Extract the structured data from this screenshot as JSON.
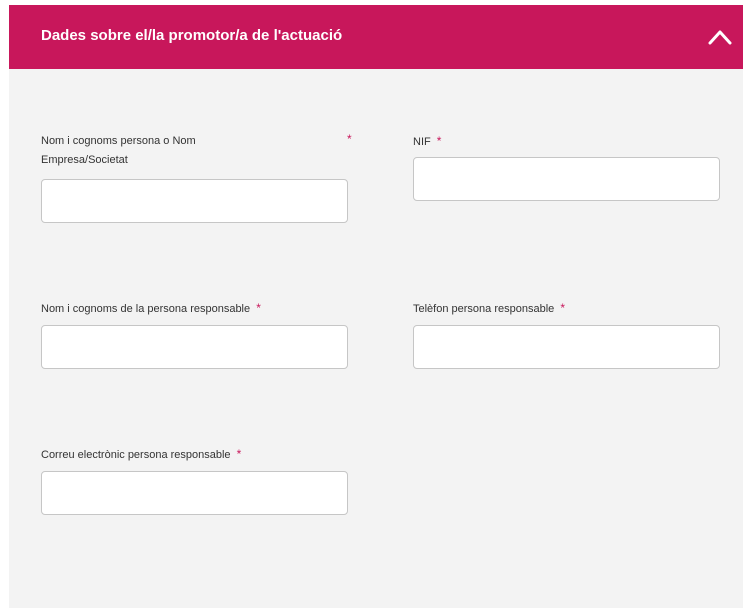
{
  "section": {
    "title": "Dades sobre el/la promotor/a de l'actuació",
    "collapse_icon": "chevron-up-icon",
    "header_color": "#c8175b"
  },
  "required_marker": "*",
  "fields": {
    "name_company": {
      "label_line1": "Nom i cognoms persona o Nom",
      "label_line2": "Empresa/Societat",
      "value": ""
    },
    "nif": {
      "label": "NIF",
      "value": ""
    },
    "responsible_name": {
      "label": "Nom i cognoms de la persona responsable",
      "value": ""
    },
    "responsible_phone": {
      "label": "Telèfon persona responsable",
      "value": ""
    },
    "responsible_email": {
      "label": "Correu electrònic persona responsable",
      "value": ""
    }
  }
}
